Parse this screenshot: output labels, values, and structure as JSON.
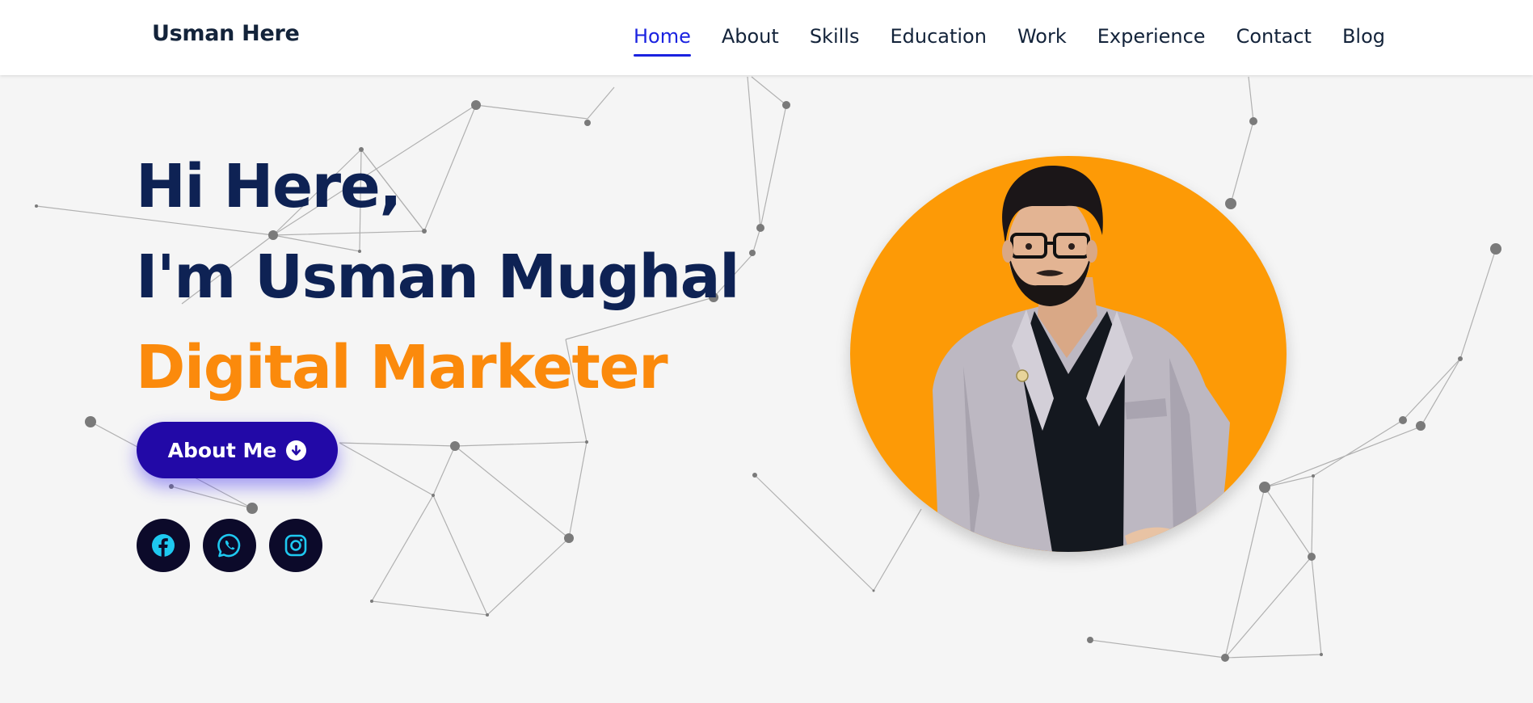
{
  "brand": "Usman Here",
  "nav": {
    "items": [
      "Home",
      "About",
      "Skills",
      "Education",
      "Work",
      "Experience",
      "Contact",
      "Blog"
    ],
    "active": "Home"
  },
  "hero": {
    "greeting": "Hi Here,",
    "name_line": "I'm Usman Mughal",
    "role": "Digital Marketer"
  },
  "cta": {
    "label": "About Me",
    "icon": "arrow-down-circle-icon"
  },
  "socials": [
    {
      "name": "facebook",
      "icon": "facebook-icon"
    },
    {
      "name": "whatsapp",
      "icon": "whatsapp-icon"
    },
    {
      "name": "instagram",
      "icon": "instagram-icon"
    }
  ],
  "colors": {
    "nav_active": "#1a22e0",
    "heading": "#0e2254",
    "accent_orange": "#fb8a0c",
    "cta_bg": "#2209a7",
    "portrait_bg": "#fd9a06",
    "social_bg": "#0c0a2a",
    "social_icon": "#1ec8f0"
  }
}
